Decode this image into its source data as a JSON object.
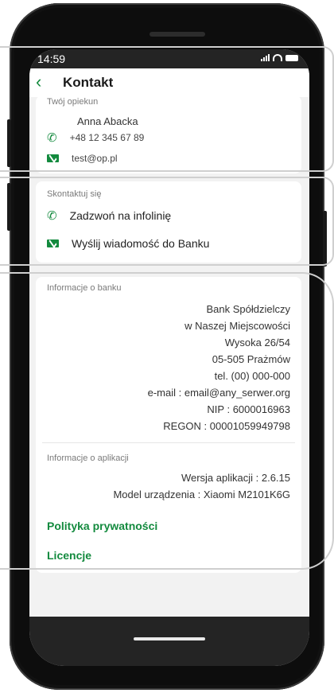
{
  "status_bar": {
    "time": "14:59"
  },
  "header": {
    "back_icon": "chevron-left-icon",
    "title": "Kontakt"
  },
  "advisor": {
    "section_title": "Twój opiekun",
    "name": "Anna Abacka",
    "phone": "+48 12 345 67 89",
    "email": "test@op.pl"
  },
  "contact": {
    "section_title": "Skontaktuj się",
    "call_label": "Zadzwoń na infolinię",
    "message_label": "Wyślij wiadomość do Banku"
  },
  "bank_info": {
    "section_title": "Informacje o banku",
    "lines": [
      "Bank Spółdzielczy",
      "w Naszej Miejscowości",
      "Wysoka 26/54",
      "05-505 Prażmów",
      "tel. (00) 000-000",
      "e-mail : email@any_serwer.org",
      "NIP : 6000016963",
      "REGON : 00001059949798"
    ]
  },
  "app_info": {
    "section_title": "Informacje o aplikacji",
    "version": "Wersja aplikacji : 2.6.15",
    "device": "Model urządzenia : Xiaomi M2101K6G"
  },
  "links": {
    "privacy": "Polityka prywatności",
    "licenses": "Licencje"
  },
  "colors": {
    "accent": "#138a3e",
    "background": "#f2f2f2",
    "bars": "#242424"
  }
}
